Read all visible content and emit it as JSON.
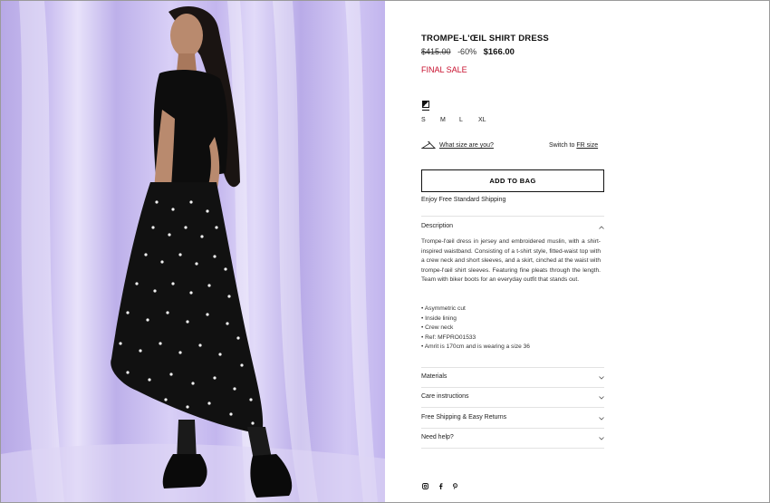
{
  "product": {
    "title": "TROMPE-L'ŒIL SHIRT DRESS",
    "old_price": "$415.00",
    "discount": "-60%",
    "new_price": "$166.00",
    "final_sale": "FINAL SALE"
  },
  "color_swatch": {
    "icon": "color-swatch-icon"
  },
  "sizes": [
    "S",
    "M",
    "L",
    "XL"
  ],
  "size_guide": {
    "icon": "hanger-icon",
    "link": "What size are you?",
    "switch_prefix": "Switch to",
    "switch_link": "FR size"
  },
  "add_to_bag": "ADD TO BAG",
  "shipping_note": "Enjoy Free Standard Shipping",
  "accordion": {
    "description": {
      "label": "Description",
      "text": "Trompe-l'œil dress in jersey and embroidered muslin, with a shirt-inspired waistband. Consisting of a t-shirt style, fitted-waist top with a crew neck and short sleeves, and a skirt, cinched at the waist with trompe-l'œil shirt sleeves. Featuring fine pleats through the length. Team with biker boots for an everyday outfit that stands out.",
      "bullets": [
        "Asymmetric cut",
        "Inside lining",
        "Crew neck",
        "Ref: MFPRO01533",
        "Amrit is 170cm and is wearing a size 36"
      ]
    },
    "materials": "Materials",
    "care": "Care instructions",
    "shipping": "Free Shipping & Easy Returns",
    "help": "Need help?"
  },
  "social_icons": [
    "instagram-icon",
    "facebook-icon",
    "pinterest-icon"
  ],
  "colors": {
    "sale_red": "#c8102e",
    "backdrop_lilac": "#c9bdf0",
    "text": "#111111"
  }
}
